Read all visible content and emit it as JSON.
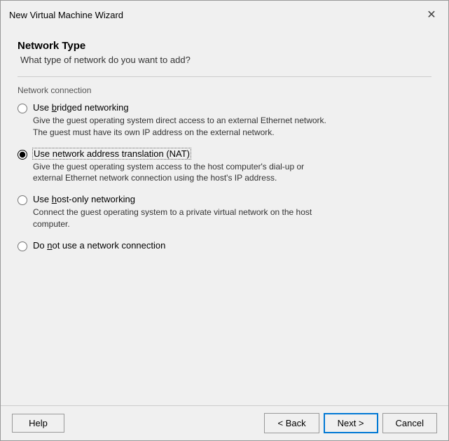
{
  "titleBar": {
    "title": "New Virtual Machine Wizard",
    "closeLabel": "✕"
  },
  "header": {
    "title": "Network Type",
    "subtitle": "What type of network do you want to add?"
  },
  "networkConnectionLabel": "Network connection",
  "options": [
    {
      "id": "bridged",
      "label": "Use bridged networking",
      "description": "Give the guest operating system direct access to an external Ethernet network.\nThe guest must have its own IP address on the external network.",
      "selected": false
    },
    {
      "id": "nat",
      "label": "Use network address translation (NAT)",
      "description": "Give the guest operating system access to the host computer's dial-up or\nexternal Ethernet network connection using the host's IP address.",
      "selected": true
    },
    {
      "id": "hostonly",
      "label": "Use host-only networking",
      "description": "Connect the guest operating system to a private virtual network on the host\ncomputer.",
      "selected": false
    },
    {
      "id": "none",
      "label": "Do not use a network connection",
      "description": "",
      "selected": false
    }
  ],
  "footer": {
    "helpLabel": "Help",
    "backLabel": "< Back",
    "nextLabel": "Next >",
    "cancelLabel": "Cancel"
  }
}
